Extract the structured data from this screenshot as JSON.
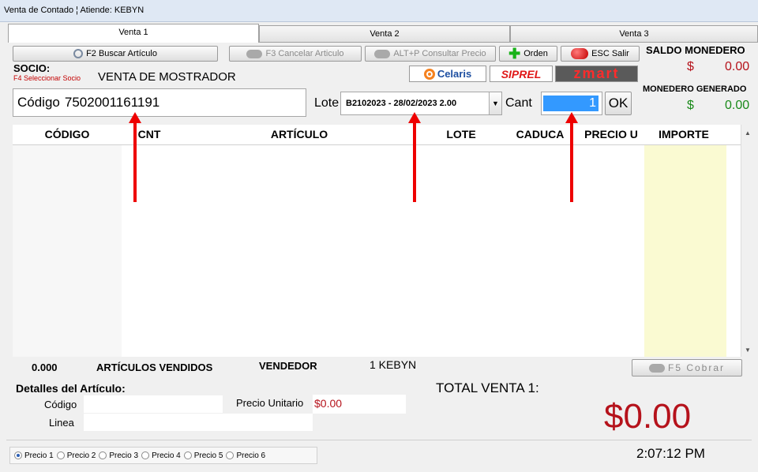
{
  "window": {
    "title": "Venta de Contado ¦ Atiende: KEBYN"
  },
  "tabs": [
    {
      "label": "Venta 1"
    },
    {
      "label": "Venta 2"
    },
    {
      "label": "Venta 3"
    }
  ],
  "toolbar": {
    "search_label": "F2 Buscar Artículo",
    "cancel_label": "F3 Cancelar Articulo",
    "price_label": "ALT+P  Consultar Precio",
    "order_label": "Orden",
    "exit_label": "ESC Salir"
  },
  "brands": [
    "Celaris",
    "SIPREL",
    "zmart"
  ],
  "socio": {
    "label": "SOCIO:",
    "hint": "F4 Seleccionar Socio",
    "value": "VENTA DE MOSTRADOR"
  },
  "wallet": {
    "saldo_title": "SALDO MONEDERO",
    "saldo_currency": "$",
    "saldo_value": "0.00",
    "generado_title": "MONEDERO GENERADO",
    "generado_currency": "$",
    "generado_value": "0.00"
  },
  "entry": {
    "codigo_label": "Código",
    "codigo_value": "7502001161191",
    "lote_label": "Lote",
    "lote_value": "B2102023 - 28/02/2023 2.00",
    "cant_label": "Cant",
    "cant_value": "1",
    "ok_label": "OK"
  },
  "grid": {
    "columns": [
      "CÓDIGO",
      "CNT",
      "ARTÍCULO",
      "LOTE",
      "CADUCA",
      "PRECIO U",
      "IMPORTE"
    ],
    "rows": []
  },
  "summary": {
    "count": "0.000",
    "count_label": "ARTÍCULOS VENDIDOS",
    "vendedor_label": "VENDEDOR",
    "vendedor_value": "1  KEBYN",
    "cobrar_label": "F5 Cobrar"
  },
  "details": {
    "title": "Detalles del Artículo:",
    "codigo_label": "Código",
    "codigo_value": "",
    "precio_label": "Precio Unitario",
    "precio_value": "$0.00",
    "linea_label": "Linea",
    "linea_value": ""
  },
  "total": {
    "label": "TOTAL VENTA 1:",
    "value": "$0.00"
  },
  "price_levels": [
    {
      "label": "Precio 1",
      "selected": true
    },
    {
      "label": "Precio 2",
      "selected": false
    },
    {
      "label": "Precio 3",
      "selected": false
    },
    {
      "label": "Precio 4",
      "selected": false
    },
    {
      "label": "Precio 5",
      "selected": false
    },
    {
      "label": "Precio 6",
      "selected": false
    }
  ],
  "clock": "2:07:12 PM",
  "colors": {
    "accent_red": "#b5121b",
    "money_green": "#1a8a1a",
    "selection_blue": "#3399ff",
    "importe_col": "#fafad2"
  }
}
